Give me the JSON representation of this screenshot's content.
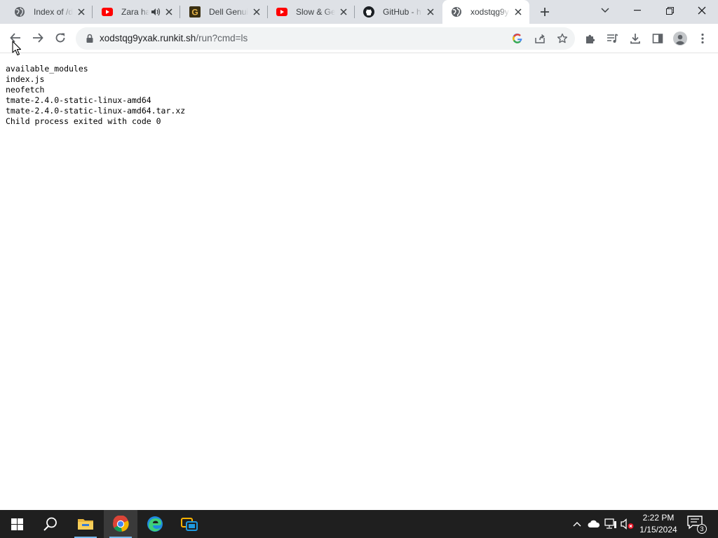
{
  "browser": {
    "tabs": [
      {
        "title": "Index of /d",
        "icon": "globe-icon",
        "active": false
      },
      {
        "title": "Zara ha",
        "icon": "youtube-icon",
        "active": false,
        "audio": true
      },
      {
        "title": "Dell Genui",
        "icon": "grammarly-g-icon",
        "active": false
      },
      {
        "title": "Slow & Ge",
        "icon": "youtube-icon",
        "active": false
      },
      {
        "title": "GitHub - h",
        "icon": "github-icon",
        "active": false
      },
      {
        "title": "xodstqg9y",
        "icon": "globe-icon",
        "active": true
      }
    ],
    "address": {
      "host": "xodstqg9yxak.runkit.sh",
      "path": "/run?cmd=ls"
    }
  },
  "page": {
    "output_lines": [
      "available_modules",
      "index.js",
      "neofetch",
      "tmate-2.4.0-static-linux-amd64",
      "tmate-2.4.0-static-linux-amd64.tar.xz",
      "Child process exited with code 0"
    ]
  },
  "taskbar": {
    "time": "2:22 PM",
    "date": "1/15/2024",
    "notification_count": "3"
  },
  "colors": {
    "tabstrip_bg": "#dee1e6",
    "taskbar_bg": "#1f1f1f",
    "youtube_red": "#ff0000",
    "accent": "#1a73e8"
  }
}
